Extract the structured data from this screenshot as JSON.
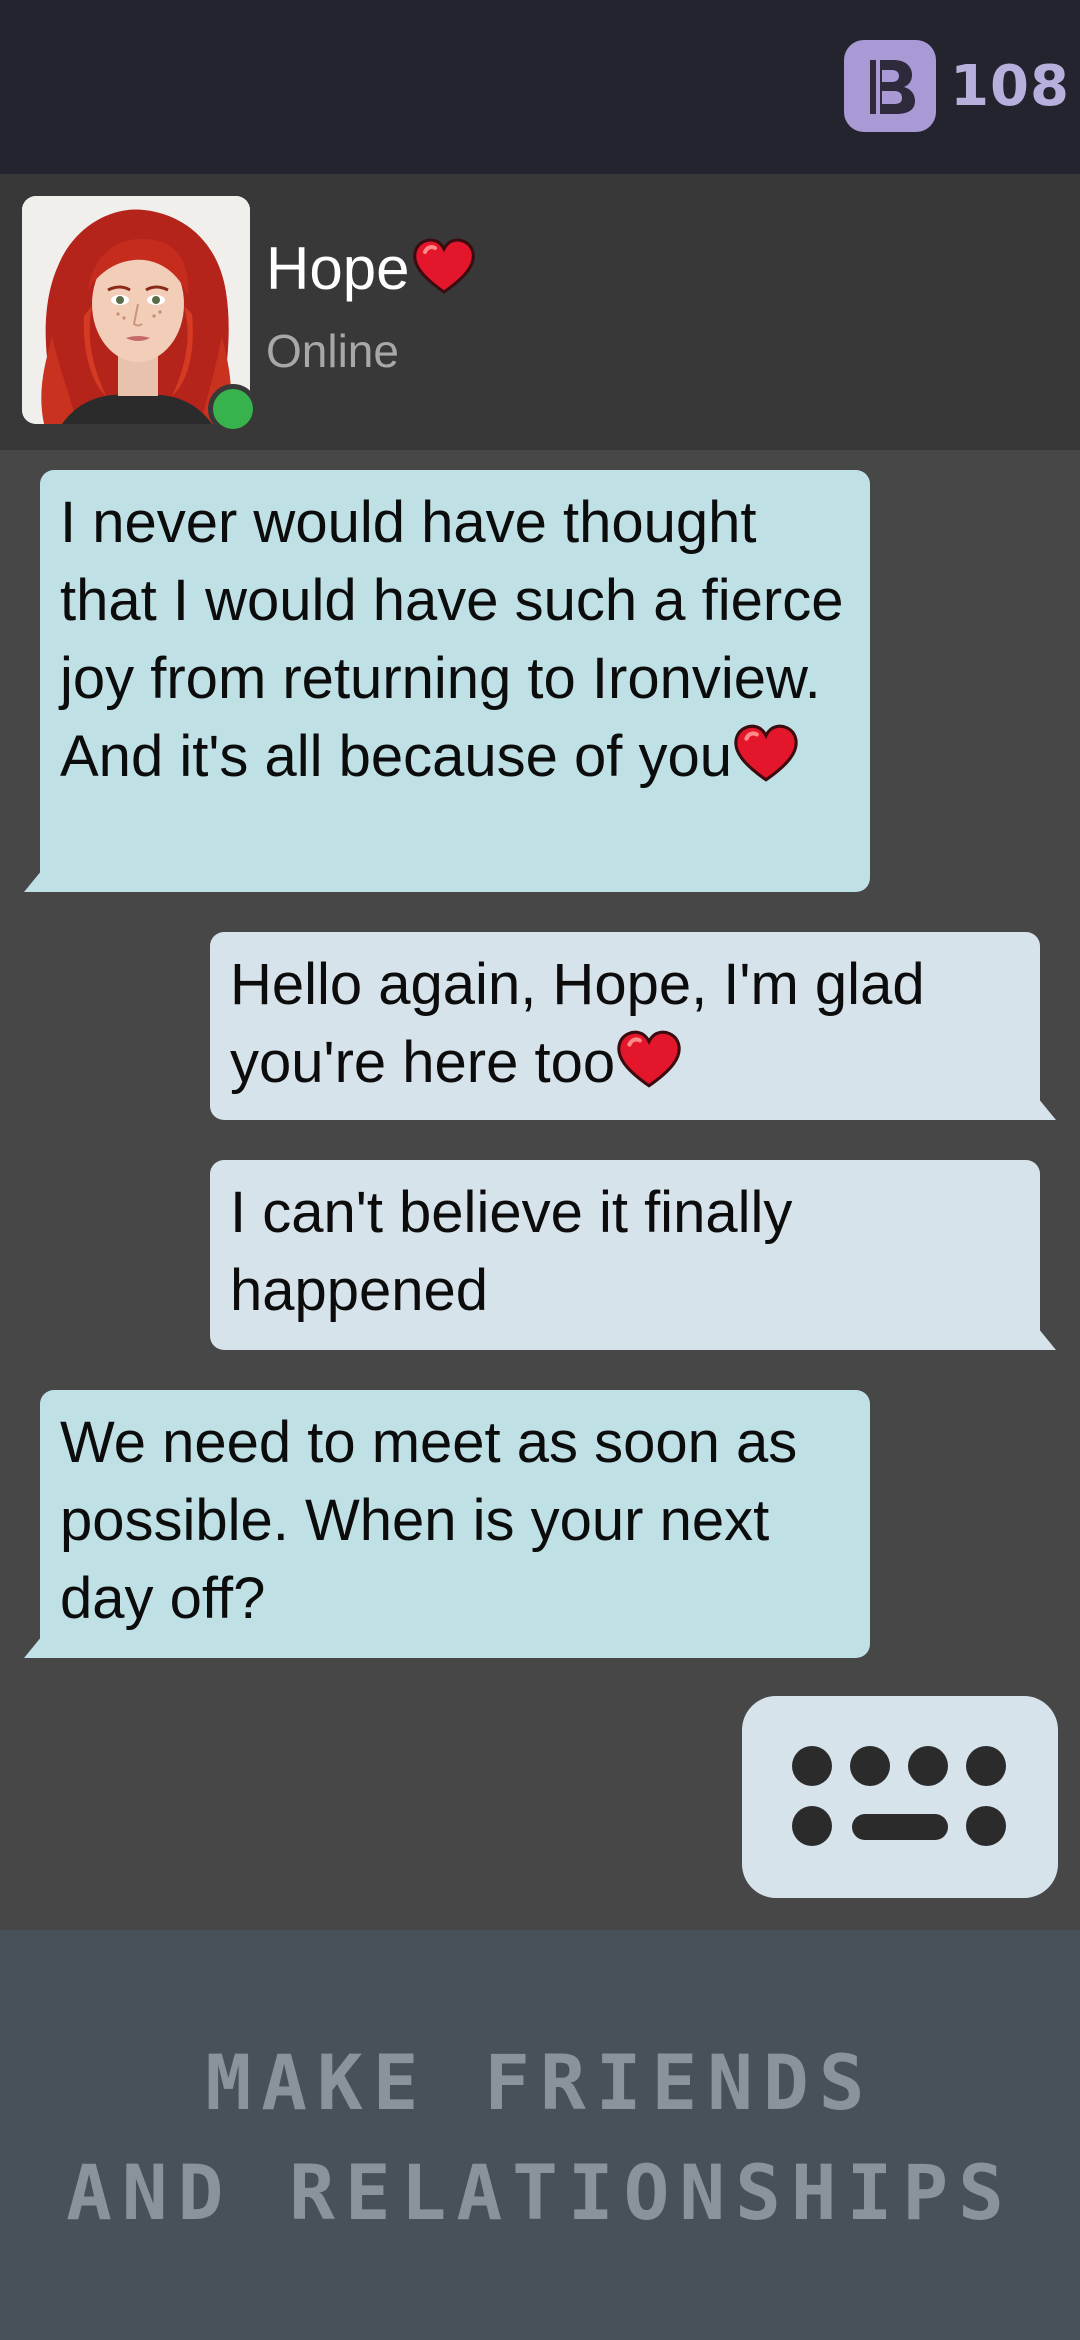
{
  "header": {
    "currency_icon": "b-coin-icon",
    "currency_value": "108",
    "currency_color": "#a99ad6"
  },
  "contact": {
    "name": "Hope",
    "name_icon": "heart-icon",
    "status": "Online",
    "status_color": "#37b24d",
    "avatar": "red-haired-woman-portrait"
  },
  "messages": [
    {
      "side": "incoming",
      "text": "I never would have thought that I would have such a fierce joy from returning to Ironview. And it's all because of you",
      "trailing_icon": "heart-icon"
    },
    {
      "side": "outgoing",
      "text": "Hello again, Hope, I'm glad you're here too",
      "trailing_icon": "heart-icon"
    },
    {
      "side": "outgoing",
      "text": "I can't believe it finally happened"
    },
    {
      "side": "incoming",
      "text": "We need to meet as soon as possible. When is your next day off?"
    }
  ],
  "input": {
    "icon": "keyboard-icon"
  },
  "banner": {
    "line1": "MAKE FRIENDS",
    "line2": "AND RELATIONSHIPS"
  },
  "colors": {
    "incoming_bubble": "#bfe0e5",
    "outgoing_bubble": "#d7e3ea",
    "background": "#474747"
  }
}
